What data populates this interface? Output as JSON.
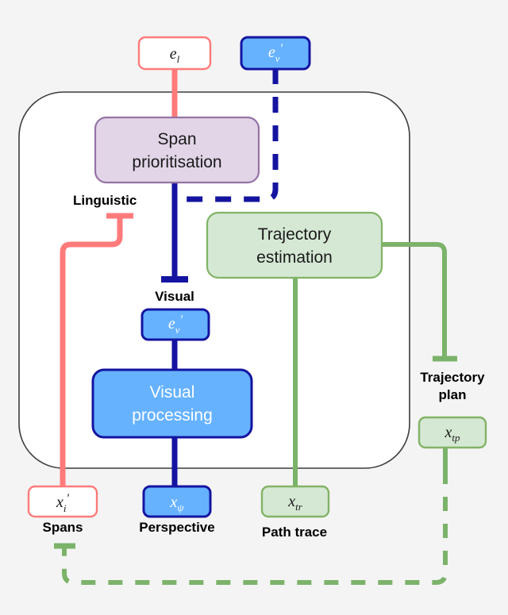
{
  "figure": {
    "background_color": "#f4f4f4",
    "container": {
      "name": "model-boundary",
      "stroke": "#3c3c3c",
      "fill": "#ffffff"
    }
  },
  "palette": {
    "red_stroke": "#ff7b7b",
    "red_fill": "#ffffff",
    "blue_dark": "#1414a0",
    "blue_fill": "#66b2ff",
    "purple_stroke": "#9673a6",
    "purple_fill": "#e1d5e7",
    "green_stroke": "#82b366",
    "green_fill": "#d5e8d4",
    "green_line": "#7cb36a",
    "text_dark": "#1a1a1a",
    "text_white": "#ffffff"
  },
  "nodes": {
    "e_l": {
      "label": "e",
      "sub": "l",
      "prime": "",
      "name": "node-e-l",
      "title": "e_l"
    },
    "e_v_prime_top": {
      "label": "e",
      "sub": "v",
      "prime": "′",
      "name": "node-e-v-prime-top",
      "title": "e'_v"
    },
    "span_prioritisation": {
      "line1": "Span",
      "line2": "prioritisation",
      "name": "node-span-prioritisation"
    },
    "trajectory_estimation": {
      "line1": "Trajectory",
      "line2": "estimation",
      "name": "node-trajectory-estimation"
    },
    "e_v_prime_mid": {
      "label": "e",
      "sub": "v",
      "prime": "′",
      "name": "node-e-v-prime-mid",
      "title": "e'_v"
    },
    "visual_processing": {
      "line1": "Visual",
      "line2": "processing",
      "name": "node-visual-processing"
    },
    "x_i_prime": {
      "label": "x",
      "sub": "i",
      "prime": "′",
      "name": "node-x-i-prime",
      "title": "x'_i"
    },
    "x_psi": {
      "label": "x",
      "sub": "ψ",
      "prime": "",
      "name": "node-x-psi",
      "title": "x_psi"
    },
    "x_tr": {
      "label": "x",
      "sub": "tr",
      "prime": "",
      "name": "node-x-tr",
      "title": "x_tr"
    },
    "x_tp": {
      "label": "x",
      "sub": "tp",
      "prime": "",
      "name": "node-x-tp",
      "title": "x_tp"
    }
  },
  "annotations": {
    "linguistic": "Linguistic",
    "visual": "Visual",
    "spans": "Spans",
    "perspective": "Perspective",
    "path_trace": "Path trace",
    "trajectory_plan_line1": "Trajectory",
    "trajectory_plan_line2": "plan"
  }
}
